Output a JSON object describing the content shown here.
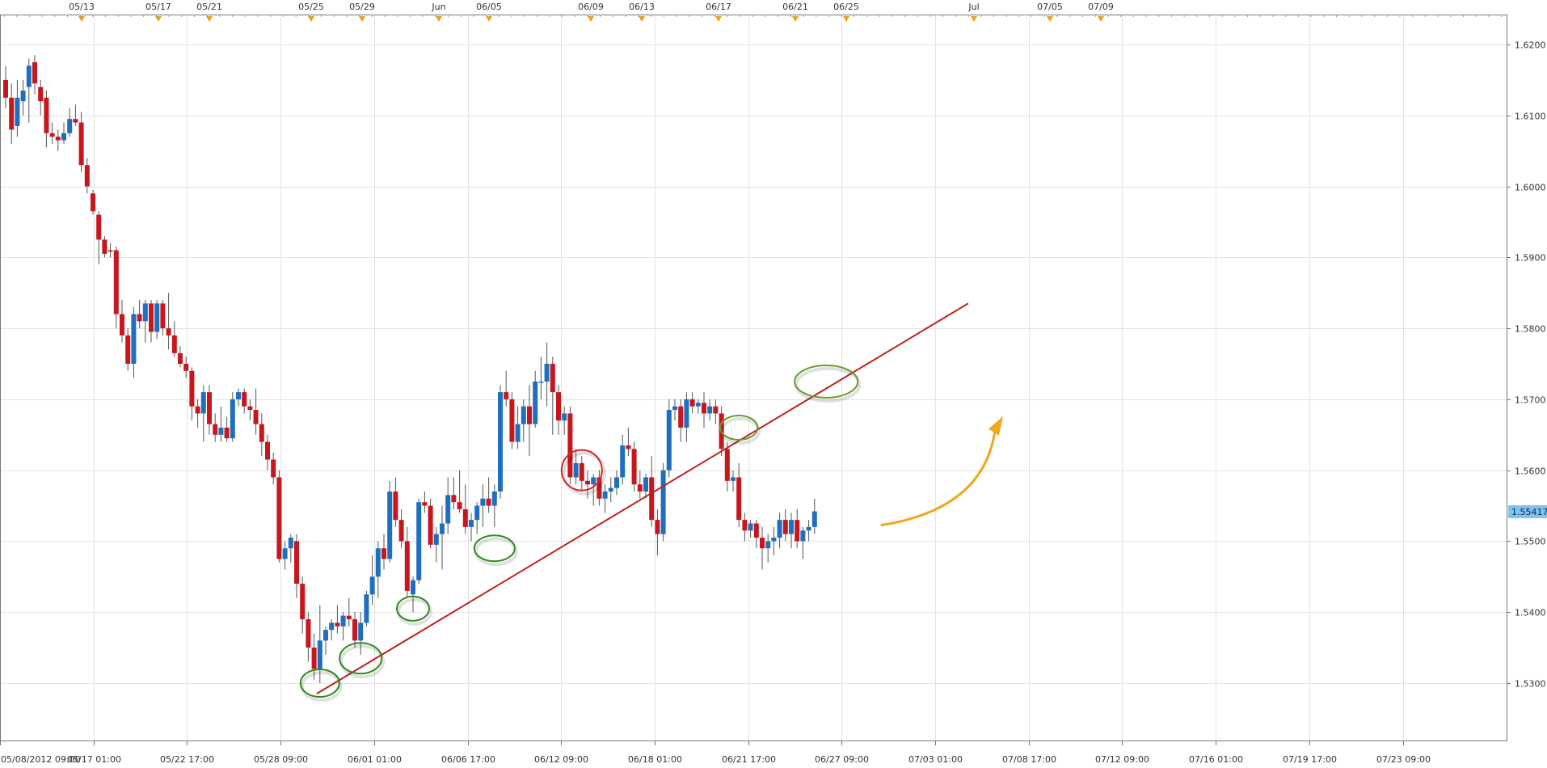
{
  "chart_data": {
    "type": "candlestick",
    "title": "",
    "xlabel": "",
    "ylabel": "",
    "ylim": [
      1.52,
      1.625
    ],
    "y_ticks": [
      "1.5300",
      "1.5400",
      "1.5500",
      "1.5600",
      "1.5700",
      "1.5800",
      "1.5900",
      "1.6000",
      "1.6100",
      "1.6200"
    ],
    "x_ticks_bottom": [
      "05/08/2012 09:00",
      "05/17 01:00",
      "05/22 17:00",
      "05/28 09:00",
      "06/01 01:00",
      "06/06 17:00",
      "06/12 09:00",
      "06/18 01:00",
      "06/21 17:00",
      "06/27 09:00",
      "07/03 01:00",
      "07/08 17:00",
      "07/12 09:00",
      "07/16 01:00",
      "07/19 17:00",
      "07/23 09:00"
    ],
    "x_ticks_top": [
      "05/13",
      "05/17",
      "05/21",
      "05/25",
      "05/29",
      "Jun",
      "06/05",
      "06/09",
      "06/13",
      "06/17",
      "06/21",
      "06/25",
      "Jul",
      "07/05",
      "07/09"
    ],
    "current_price": "1.55417",
    "grid": true,
    "colors": {
      "up": "#1f6fc0",
      "down": "#c8161d",
      "trendline": "#c0201e",
      "arrow": "#f0a81e",
      "badge": "#7fc3ee"
    },
    "candles": [
      {
        "o": 1.615,
        "h": 1.617,
        "l": 1.611,
        "c": 1.6125
      },
      {
        "o": 1.6125,
        "h": 1.6145,
        "l": 1.606,
        "c": 1.608
      },
      {
        "o": 1.6085,
        "h": 1.615,
        "l": 1.607,
        "c": 1.6125
      },
      {
        "o": 1.612,
        "h": 1.615,
        "l": 1.61,
        "c": 1.6135
      },
      {
        "o": 1.614,
        "h": 1.618,
        "l": 1.609,
        "c": 1.617
      },
      {
        "o": 1.6175,
        "h": 1.6185,
        "l": 1.613,
        "c": 1.6145
      },
      {
        "o": 1.614,
        "h": 1.615,
        "l": 1.61,
        "c": 1.612
      },
      {
        "o": 1.6125,
        "h": 1.6135,
        "l": 1.6055,
        "c": 1.6075
      },
      {
        "o": 1.6075,
        "h": 1.609,
        "l": 1.606,
        "c": 1.607
      },
      {
        "o": 1.607,
        "h": 1.608,
        "l": 1.605,
        "c": 1.6065
      },
      {
        "o": 1.6065,
        "h": 1.609,
        "l": 1.606,
        "c": 1.6075
      },
      {
        "o": 1.6075,
        "h": 1.611,
        "l": 1.607,
        "c": 1.6095
      },
      {
        "o": 1.6095,
        "h": 1.6115,
        "l": 1.6085,
        "c": 1.609
      },
      {
        "o": 1.609,
        "h": 1.6105,
        "l": 1.602,
        "c": 1.603
      },
      {
        "o": 1.603,
        "h": 1.604,
        "l": 1.599,
        "c": 1.6
      },
      {
        "o": 1.599,
        "h": 1.5995,
        "l": 1.596,
        "c": 1.5965
      },
      {
        "o": 1.596,
        "h": 1.5965,
        "l": 1.589,
        "c": 1.5925
      },
      {
        "o": 1.5925,
        "h": 1.593,
        "l": 1.59,
        "c": 1.5905
      },
      {
        "o": 1.591,
        "h": 1.592,
        "l": 1.59,
        "c": 1.5908
      },
      {
        "o": 1.591,
        "h": 1.5915,
        "l": 1.58,
        "c": 1.582
      },
      {
        "o": 1.582,
        "h": 1.584,
        "l": 1.578,
        "c": 1.579
      },
      {
        "o": 1.579,
        "h": 1.58,
        "l": 1.574,
        "c": 1.575
      },
      {
        "o": 1.575,
        "h": 1.583,
        "l": 1.573,
        "c": 1.582
      },
      {
        "o": 1.582,
        "h": 1.584,
        "l": 1.58,
        "c": 1.581
      },
      {
        "o": 1.581,
        "h": 1.584,
        "l": 1.578,
        "c": 1.5835
      },
      {
        "o": 1.5835,
        "h": 1.584,
        "l": 1.578,
        "c": 1.5795
      },
      {
        "o": 1.5795,
        "h": 1.584,
        "l": 1.5785,
        "c": 1.5835
      },
      {
        "o": 1.5835,
        "h": 1.584,
        "l": 1.579,
        "c": 1.58
      },
      {
        "o": 1.58,
        "h": 1.585,
        "l": 1.577,
        "c": 1.579
      },
      {
        "o": 1.579,
        "h": 1.581,
        "l": 1.576,
        "c": 1.5765
      },
      {
        "o": 1.5765,
        "h": 1.5775,
        "l": 1.5745,
        "c": 1.575
      },
      {
        "o": 1.575,
        "h": 1.576,
        "l": 1.573,
        "c": 1.574
      },
      {
        "o": 1.574,
        "h": 1.5745,
        "l": 1.567,
        "c": 1.569
      },
      {
        "o": 1.569,
        "h": 1.57,
        "l": 1.566,
        "c": 1.568
      },
      {
        "o": 1.568,
        "h": 1.572,
        "l": 1.564,
        "c": 1.571
      },
      {
        "o": 1.571,
        "h": 1.572,
        "l": 1.565,
        "c": 1.5665
      },
      {
        "o": 1.5665,
        "h": 1.568,
        "l": 1.564,
        "c": 1.565
      },
      {
        "o": 1.565,
        "h": 1.569,
        "l": 1.564,
        "c": 1.566
      },
      {
        "o": 1.566,
        "h": 1.5675,
        "l": 1.564,
        "c": 1.5645
      },
      {
        "o": 1.5645,
        "h": 1.571,
        "l": 1.564,
        "c": 1.57
      },
      {
        "o": 1.57,
        "h": 1.5715,
        "l": 1.569,
        "c": 1.571
      },
      {
        "o": 1.571,
        "h": 1.5715,
        "l": 1.568,
        "c": 1.569
      },
      {
        "o": 1.569,
        "h": 1.57,
        "l": 1.567,
        "c": 1.5685
      },
      {
        "o": 1.5685,
        "h": 1.5715,
        "l": 1.565,
        "c": 1.5665
      },
      {
        "o": 1.5665,
        "h": 1.568,
        "l": 1.562,
        "c": 1.564
      },
      {
        "o": 1.564,
        "h": 1.565,
        "l": 1.56,
        "c": 1.5615
      },
      {
        "o": 1.5615,
        "h": 1.5625,
        "l": 1.558,
        "c": 1.559
      },
      {
        "o": 1.559,
        "h": 1.56,
        "l": 1.547,
        "c": 1.5475
      },
      {
        "o": 1.5475,
        "h": 1.55,
        "l": 1.546,
        "c": 1.549
      },
      {
        "o": 1.549,
        "h": 1.551,
        "l": 1.547,
        "c": 1.5505
      },
      {
        "o": 1.55,
        "h": 1.551,
        "l": 1.542,
        "c": 1.544
      },
      {
        "o": 1.544,
        "h": 1.545,
        "l": 1.537,
        "c": 1.539
      },
      {
        "o": 1.539,
        "h": 1.54,
        "l": 1.533,
        "c": 1.535
      },
      {
        "o": 1.535,
        "h": 1.537,
        "l": 1.5305,
        "c": 1.532
      },
      {
        "o": 1.532,
        "h": 1.541,
        "l": 1.53,
        "c": 1.536
      },
      {
        "o": 1.536,
        "h": 1.538,
        "l": 1.534,
        "c": 1.5375
      },
      {
        "o": 1.5375,
        "h": 1.539,
        "l": 1.536,
        "c": 1.5385
      },
      {
        "o": 1.5385,
        "h": 1.541,
        "l": 1.537,
        "c": 1.538
      },
      {
        "o": 1.538,
        "h": 1.54,
        "l": 1.536,
        "c": 1.5395
      },
      {
        "o": 1.5395,
        "h": 1.542,
        "l": 1.538,
        "c": 1.539
      },
      {
        "o": 1.539,
        "h": 1.54,
        "l": 1.535,
        "c": 1.536
      },
      {
        "o": 1.536,
        "h": 1.54,
        "l": 1.534,
        "c": 1.5385
      },
      {
        "o": 1.5385,
        "h": 1.543,
        "l": 1.538,
        "c": 1.5425
      },
      {
        "o": 1.5425,
        "h": 1.548,
        "l": 1.541,
        "c": 1.545
      },
      {
        "o": 1.545,
        "h": 1.55,
        "l": 1.542,
        "c": 1.549
      },
      {
        "o": 1.549,
        "h": 1.551,
        "l": 1.546,
        "c": 1.5475
      },
      {
        "o": 1.5475,
        "h": 1.5585,
        "l": 1.547,
        "c": 1.557
      },
      {
        "o": 1.557,
        "h": 1.559,
        "l": 1.552,
        "c": 1.553
      },
      {
        "o": 1.553,
        "h": 1.5545,
        "l": 1.549,
        "c": 1.55
      },
      {
        "o": 1.55,
        "h": 1.552,
        "l": 1.542,
        "c": 1.543
      },
      {
        "o": 1.5425,
        "h": 1.545,
        "l": 1.54,
        "c": 1.5445
      },
      {
        "o": 1.5445,
        "h": 1.556,
        "l": 1.544,
        "c": 1.5555
      },
      {
        "o": 1.5555,
        "h": 1.557,
        "l": 1.554,
        "c": 1.555
      },
      {
        "o": 1.555,
        "h": 1.556,
        "l": 1.549,
        "c": 1.5495
      },
      {
        "o": 1.5495,
        "h": 1.552,
        "l": 1.547,
        "c": 1.551
      },
      {
        "o": 1.551,
        "h": 1.555,
        "l": 1.546,
        "c": 1.5525
      },
      {
        "o": 1.5525,
        "h": 1.559,
        "l": 1.551,
        "c": 1.5565
      },
      {
        "o": 1.5565,
        "h": 1.559,
        "l": 1.5545,
        "c": 1.5555
      },
      {
        "o": 1.5555,
        "h": 1.56,
        "l": 1.554,
        "c": 1.5545
      },
      {
        "o": 1.5545,
        "h": 1.558,
        "l": 1.551,
        "c": 1.552
      },
      {
        "o": 1.552,
        "h": 1.554,
        "l": 1.55,
        "c": 1.553
      },
      {
        "o": 1.553,
        "h": 1.5555,
        "l": 1.551,
        "c": 1.555
      },
      {
        "o": 1.555,
        "h": 1.558,
        "l": 1.552,
        "c": 1.556
      },
      {
        "o": 1.556,
        "h": 1.559,
        "l": 1.554,
        "c": 1.555
      },
      {
        "o": 1.555,
        "h": 1.558,
        "l": 1.552,
        "c": 1.557
      },
      {
        "o": 1.557,
        "h": 1.572,
        "l": 1.556,
        "c": 1.571
      },
      {
        "o": 1.571,
        "h": 1.574,
        "l": 1.569,
        "c": 1.57
      },
      {
        "o": 1.57,
        "h": 1.571,
        "l": 1.563,
        "c": 1.564
      },
      {
        "o": 1.564,
        "h": 1.569,
        "l": 1.563,
        "c": 1.5665
      },
      {
        "o": 1.5665,
        "h": 1.57,
        "l": 1.564,
        "c": 1.569
      },
      {
        "o": 1.569,
        "h": 1.572,
        "l": 1.562,
        "c": 1.5665
      },
      {
        "o": 1.5665,
        "h": 1.574,
        "l": 1.566,
        "c": 1.5725
      },
      {
        "o": 1.5725,
        "h": 1.576,
        "l": 1.57,
        "c": 1.5725
      },
      {
        "o": 1.5725,
        "h": 1.578,
        "l": 1.569,
        "c": 1.575
      },
      {
        "o": 1.575,
        "h": 1.576,
        "l": 1.565,
        "c": 1.571
      },
      {
        "o": 1.571,
        "h": 1.572,
        "l": 1.565,
        "c": 1.567
      },
      {
        "o": 1.567,
        "h": 1.569,
        "l": 1.565,
        "c": 1.568
      },
      {
        "o": 1.568,
        "h": 1.569,
        "l": 1.558,
        "c": 1.559
      },
      {
        "o": 1.559,
        "h": 1.563,
        "l": 1.558,
        "c": 1.561
      },
      {
        "o": 1.561,
        "h": 1.562,
        "l": 1.557,
        "c": 1.5585
      },
      {
        "o": 1.5585,
        "h": 1.56,
        "l": 1.556,
        "c": 1.558
      },
      {
        "o": 1.558,
        "h": 1.5595,
        "l": 1.555,
        "c": 1.559
      },
      {
        "o": 1.559,
        "h": 1.56,
        "l": 1.555,
        "c": 1.556
      },
      {
        "o": 1.556,
        "h": 1.558,
        "l": 1.554,
        "c": 1.557
      },
      {
        "o": 1.557,
        "h": 1.559,
        "l": 1.5555,
        "c": 1.5575
      },
      {
        "o": 1.5575,
        "h": 1.56,
        "l": 1.5565,
        "c": 1.559
      },
      {
        "o": 1.559,
        "h": 1.565,
        "l": 1.558,
        "c": 1.5635
      },
      {
        "o": 1.5635,
        "h": 1.566,
        "l": 1.562,
        "c": 1.563
      },
      {
        "o": 1.563,
        "h": 1.564,
        "l": 1.557,
        "c": 1.558
      },
      {
        "o": 1.558,
        "h": 1.56,
        "l": 1.556,
        "c": 1.557
      },
      {
        "o": 1.557,
        "h": 1.5595,
        "l": 1.556,
        "c": 1.559
      },
      {
        "o": 1.559,
        "h": 1.562,
        "l": 1.552,
        "c": 1.553
      },
      {
        "o": 1.553,
        "h": 1.5545,
        "l": 1.548,
        "c": 1.551
      },
      {
        "o": 1.551,
        "h": 1.561,
        "l": 1.55,
        "c": 1.56
      },
      {
        "o": 1.56,
        "h": 1.57,
        "l": 1.559,
        "c": 1.5685
      },
      {
        "o": 1.5685,
        "h": 1.57,
        "l": 1.567,
        "c": 1.569
      },
      {
        "o": 1.569,
        "h": 1.57,
        "l": 1.564,
        "c": 1.566
      },
      {
        "o": 1.566,
        "h": 1.571,
        "l": 1.564,
        "c": 1.57
      },
      {
        "o": 1.57,
        "h": 1.571,
        "l": 1.568,
        "c": 1.569
      },
      {
        "o": 1.569,
        "h": 1.57,
        "l": 1.568,
        "c": 1.5695
      },
      {
        "o": 1.5695,
        "h": 1.571,
        "l": 1.566,
        "c": 1.568
      },
      {
        "o": 1.568,
        "h": 1.57,
        "l": 1.567,
        "c": 1.569
      },
      {
        "o": 1.569,
        "h": 1.57,
        "l": 1.5665,
        "c": 1.568
      },
      {
        "o": 1.568,
        "h": 1.569,
        "l": 1.562,
        "c": 1.563
      },
      {
        "o": 1.563,
        "h": 1.564,
        "l": 1.557,
        "c": 1.5585
      },
      {
        "o": 1.5585,
        "h": 1.56,
        "l": 1.557,
        "c": 1.559
      },
      {
        "o": 1.559,
        "h": 1.561,
        "l": 1.552,
        "c": 1.553
      },
      {
        "o": 1.553,
        "h": 1.554,
        "l": 1.55,
        "c": 1.5515
      },
      {
        "o": 1.5515,
        "h": 1.553,
        "l": 1.5505,
        "c": 1.5525
      },
      {
        "o": 1.5525,
        "h": 1.553,
        "l": 1.549,
        "c": 1.5505
      },
      {
        "o": 1.5505,
        "h": 1.552,
        "l": 1.546,
        "c": 1.549
      },
      {
        "o": 1.549,
        "h": 1.551,
        "l": 1.547,
        "c": 1.55
      },
      {
        "o": 1.55,
        "h": 1.552,
        "l": 1.548,
        "c": 1.5505
      },
      {
        "o": 1.5505,
        "h": 1.554,
        "l": 1.549,
        "c": 1.553
      },
      {
        "o": 1.553,
        "h": 1.5545,
        "l": 1.55,
        "c": 1.551
      },
      {
        "o": 1.551,
        "h": 1.554,
        "l": 1.549,
        "c": 1.553
      },
      {
        "o": 1.553,
        "h": 1.5545,
        "l": 1.549,
        "c": 1.55
      },
      {
        "o": 1.55,
        "h": 1.552,
        "l": 1.5475,
        "c": 1.5515
      },
      {
        "o": 1.5515,
        "h": 1.553,
        "l": 1.55,
        "c": 1.552
      },
      {
        "o": 1.552,
        "h": 1.556,
        "l": 1.551,
        "c": 1.5542
      }
    ],
    "annotations": {
      "trendline": {
        "from": {
          "candle": 54,
          "price": 1.5285
        },
        "to": {
          "candle": 164,
          "price": 1.5835
        }
      },
      "support_touches": [
        {
          "candle": 54,
          "price": 1.53
        },
        {
          "candle": 61,
          "price": 1.5335
        },
        {
          "candle": 70,
          "price": 1.5405
        },
        {
          "candle": 84,
          "price": 1.549
        },
        {
          "candle": 126,
          "price": 1.566
        },
        {
          "candle": 141,
          "price": 1.5725
        }
      ],
      "break_marker": {
        "candle": 99,
        "price": 1.56
      },
      "projection_arrow": {
        "from": {
          "candle": 150,
          "price": 1.5525
        },
        "to": {
          "candle": 160,
          "price": 1.5665
        }
      }
    }
  }
}
